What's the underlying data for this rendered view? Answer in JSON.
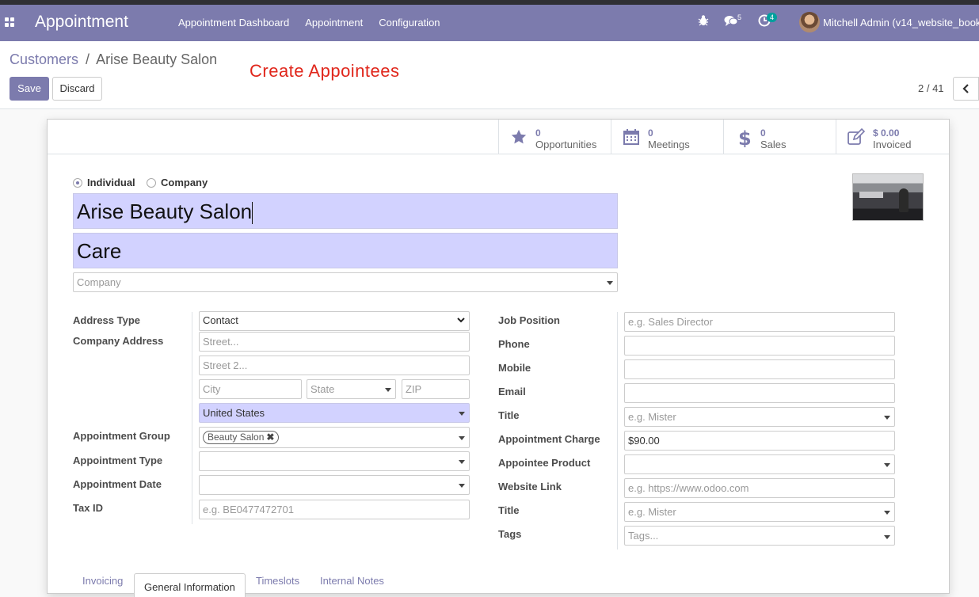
{
  "navbar": {
    "app_title": "Appointment",
    "menu": [
      "Appointment Dashboard",
      "Appointment",
      "Configuration"
    ],
    "messages_badge": "5",
    "activities_badge": "4",
    "user": "Mitchell Admin (v14_website_book"
  },
  "breadcrumb": {
    "parent": "Customers",
    "separator": "/",
    "current": "Arise Beauty Salon"
  },
  "annotation": "Create Appointees",
  "buttons": {
    "save": "Save",
    "discard": "Discard"
  },
  "pager": {
    "text": "2 / 41"
  },
  "stat_buttons": [
    {
      "value": "0",
      "label": "Opportunities",
      "icon": "star-icon"
    },
    {
      "value": "0",
      "label": "Meetings",
      "icon": "calendar-icon"
    },
    {
      "value": "0",
      "label": "Sales",
      "icon": "dollar-icon"
    },
    {
      "value": "$ 0.00",
      "label": "Invoiced",
      "icon": "edit-icon"
    }
  ],
  "company_type": {
    "individual": "Individual",
    "company": "Company",
    "selected": "Individual"
  },
  "name": "Arise Beauty Salon",
  "subtitle": "Care",
  "company_placeholder": "Company",
  "left_fields": {
    "address_type_label": "Address Type",
    "address_type_value": "Contact",
    "company_address_label": "Company Address",
    "street_ph": "Street...",
    "street2_ph": "Street 2...",
    "city_ph": "City",
    "state_ph": "State",
    "zip_ph": "ZIP",
    "country_value": "United States",
    "appointment_group_label": "Appointment Group",
    "appointment_group_tag": "Beauty Salon",
    "appointment_type_label": "Appointment Type",
    "appointment_date_label": "Appointment Date",
    "tax_id_label": "Tax ID",
    "tax_id_ph": "e.g. BE0477472701"
  },
  "right_fields": {
    "job_position_label": "Job Position",
    "job_position_ph": "e.g. Sales Director",
    "phone_label": "Phone",
    "mobile_label": "Mobile",
    "email_label": "Email",
    "title_label": "Title",
    "title_ph": "e.g. Mister",
    "appointment_charge_label": "Appointment Charge",
    "appointment_charge_value": "$90.00",
    "appointee_product_label": "Appointee Product",
    "website_link_label": "Website Link",
    "website_link_ph": "e.g. https://www.odoo.com",
    "title2_label": "Title",
    "title2_ph": "e.g. Mister",
    "tags_label": "Tags",
    "tags_ph": "Tags..."
  },
  "tabs": [
    "Invoicing",
    "General Information",
    "Timeslots",
    "Internal Notes"
  ],
  "colors": {
    "brand": "#7c7bad",
    "highlight": "#d2d2ff",
    "annotation": "#e0261b"
  }
}
